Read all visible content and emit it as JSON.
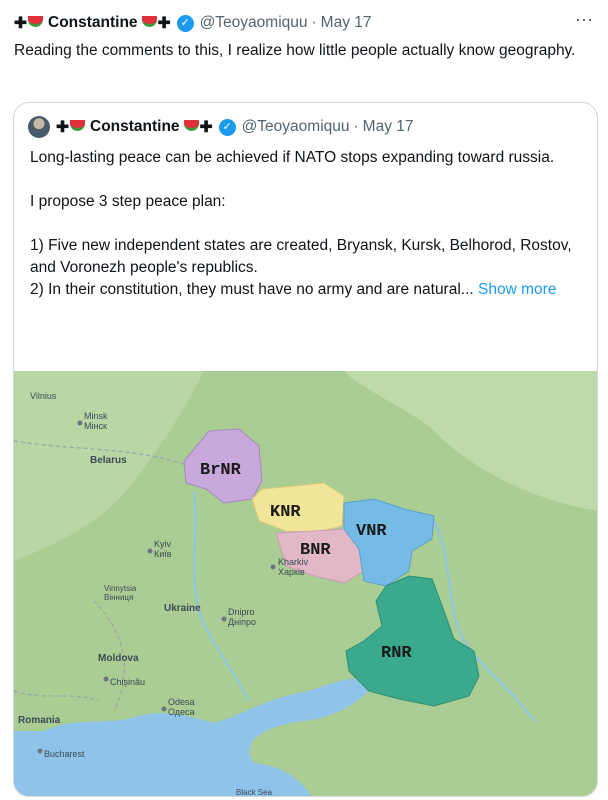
{
  "tweet": {
    "author_name": "Constantine",
    "prefix_symbol": "✚",
    "suffix_symbol": "✚",
    "handle": "@Teoyaomiquu",
    "separator": "·",
    "date": "May 17",
    "more_icon": "⋯",
    "text": "Reading the comments to this, I realize how little people actually know geography."
  },
  "quoted": {
    "author_name": "Constantine",
    "prefix_symbol": "✚",
    "suffix_symbol": "✚",
    "handle": "@Teoyaomiquu",
    "separator": "·",
    "date": "May 17",
    "text": "Long-lasting peace can be achieved if NATO stops expanding toward russia.\n\nI propose 3 step peace plan:\n\n1) Five new independent states are created, Bryansk, Kursk, Belhorod, Rostov, and Voronezh people's republics.\n2) In their constitution, they must have no army and are natural...",
    "show_more": "Show more"
  },
  "map": {
    "places": {
      "vilnius": "Vilnius",
      "minsk": "Minsk",
      "minsk_cyr": "Мінск",
      "belarus": "Belarus",
      "kyiv": "Kyiv",
      "kyiv_cyr": "Київ",
      "kharkiv": "Kharkiv",
      "kharkiv_cyr": "Харків",
      "vinnytsia": "Vinnytsia",
      "vinnytsia_cyr": "Вінниця",
      "ukraine": "Ukraine",
      "dnipro": "Dnipro",
      "dnipro_cyr": "Дніпро",
      "moldova": "Moldova",
      "chisinau": "Chișinău",
      "odesa": "Odesa",
      "odesa_cyr": "Одеса",
      "romania": "Romania",
      "bucharest": "Bucharest",
      "black_sea": "Black Sea"
    },
    "regions": {
      "brnr": "BrNR",
      "knr": "KNR",
      "bnr": "BNR",
      "vnr": "VNR",
      "rnr": "RNR"
    },
    "colors": {
      "brnr": "#c9a9dc",
      "knr": "#f1e59a",
      "bnr": "#e2b8c8",
      "vnr": "#74bbe6",
      "rnr": "#3aa98c",
      "land": "#a9cd93",
      "sea": "#8fc3ea"
    }
  }
}
